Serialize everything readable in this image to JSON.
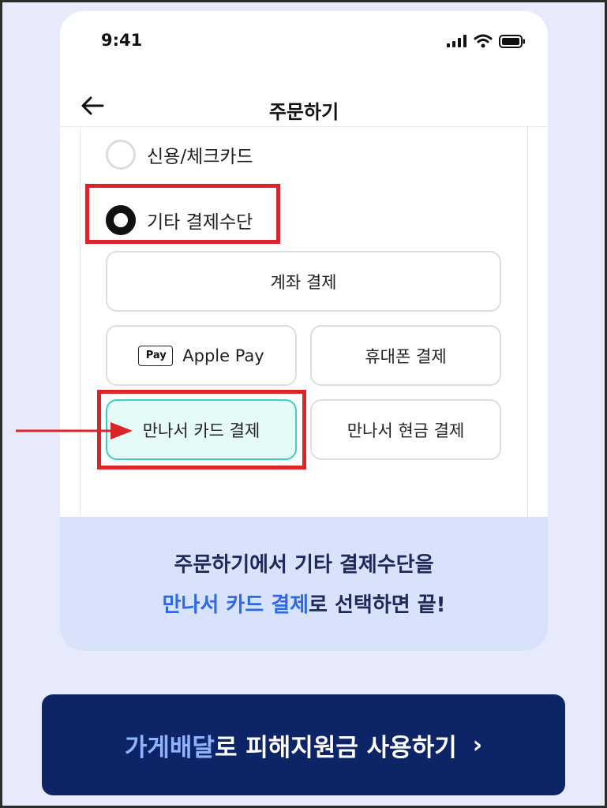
{
  "status_bar": {
    "time": "9:41",
    "icons": [
      "signal-icon",
      "wifi-icon",
      "battery-icon"
    ]
  },
  "nav": {
    "back_icon": "arrow-left-icon",
    "title": "주문하기"
  },
  "payment_options": [
    {
      "label": "신용/체크카드",
      "selected": false
    },
    {
      "label": "기타 결제수단",
      "selected": true
    }
  ],
  "methods": {
    "bank_transfer": "계좌 결제",
    "apple_pay_badge": "Pay",
    "apple_pay": "Apple Pay",
    "mobile": "휴대폰 결제",
    "meet_card": "만나서 카드 결제",
    "meet_cash": "만나서 현금 결제"
  },
  "info": {
    "line1": "주문하기에서 기타 결제수단을",
    "line2_highlight": "만나서 카드 결제",
    "line2_rest": "로 선택하면 끝!"
  },
  "cta": {
    "highlight": "가게배달",
    "rest": "로 피해지원금 사용하기",
    "chevron": "›"
  },
  "colors": {
    "background": "#e6eafb",
    "annotation_red": "#d9252a",
    "selected_fill": "#e5fbf8",
    "selected_border": "#3ed0bd",
    "info_bg": "#d8e3fb",
    "highlight_blue": "#2f68e6",
    "cta_bg": "#0d2566",
    "cta_highlight": "#8fb3ff"
  }
}
